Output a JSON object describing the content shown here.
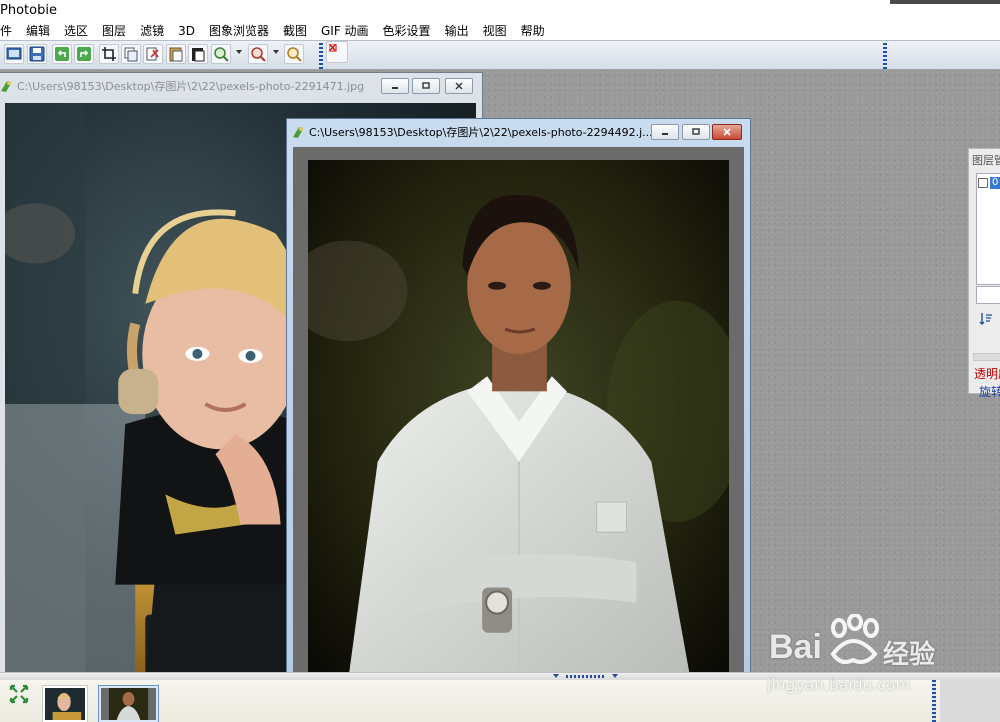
{
  "app": {
    "title": "Photobie"
  },
  "menu": [
    {
      "label": "件"
    },
    {
      "label": "编辑"
    },
    {
      "label": "选区"
    },
    {
      "label": "图层"
    },
    {
      "label": "滤镜"
    },
    {
      "label": "3D"
    },
    {
      "label": "图象浏览器"
    },
    {
      "label": "截图"
    },
    {
      "label": "GIF 动画"
    },
    {
      "label": "色彩设置"
    },
    {
      "label": "输出"
    },
    {
      "label": "视图"
    },
    {
      "label": "帮助"
    }
  ],
  "toolbar": {
    "buttons": [
      "new-image-icon",
      "save-icon",
      "undo-icon",
      "redo-icon",
      "crop-icon",
      "copy-icon",
      "cut-icon",
      "paste-icon",
      "paste-new-icon",
      "zoom-in-icon",
      "zoom-out-icon",
      "zoom-fit-icon",
      "close-icon"
    ]
  },
  "documents": [
    {
      "title": "C:\\Users\\98153\\Desktop\\存图片\\2\\22\\pexels-photo-2291471.jpg",
      "active": false
    },
    {
      "title": "C:\\Users\\98153\\Desktop\\存图片\\2\\22\\pexels-photo-2294492.j...",
      "active": true
    }
  ],
  "layer_panel": {
    "title": "图层管",
    "layer_name": "0",
    "transparency_label": "透明度",
    "rotate_label": "旋转"
  },
  "thumbnails": [
    {
      "name": "pexels-photo-2291471",
      "selected": false
    },
    {
      "name": "pexels-photo-2294492",
      "selected": true
    }
  ],
  "watermark": {
    "brand": "Bai",
    "suffix": "经验",
    "url": "jingyan.baidu.com"
  },
  "colors": {
    "titlebar_active": "#c6dbef",
    "workspace": "#9a9a9a",
    "close_button": "#c64a36",
    "selection": "#3a78d6",
    "toolbar_separator": "#1f4fa8"
  }
}
